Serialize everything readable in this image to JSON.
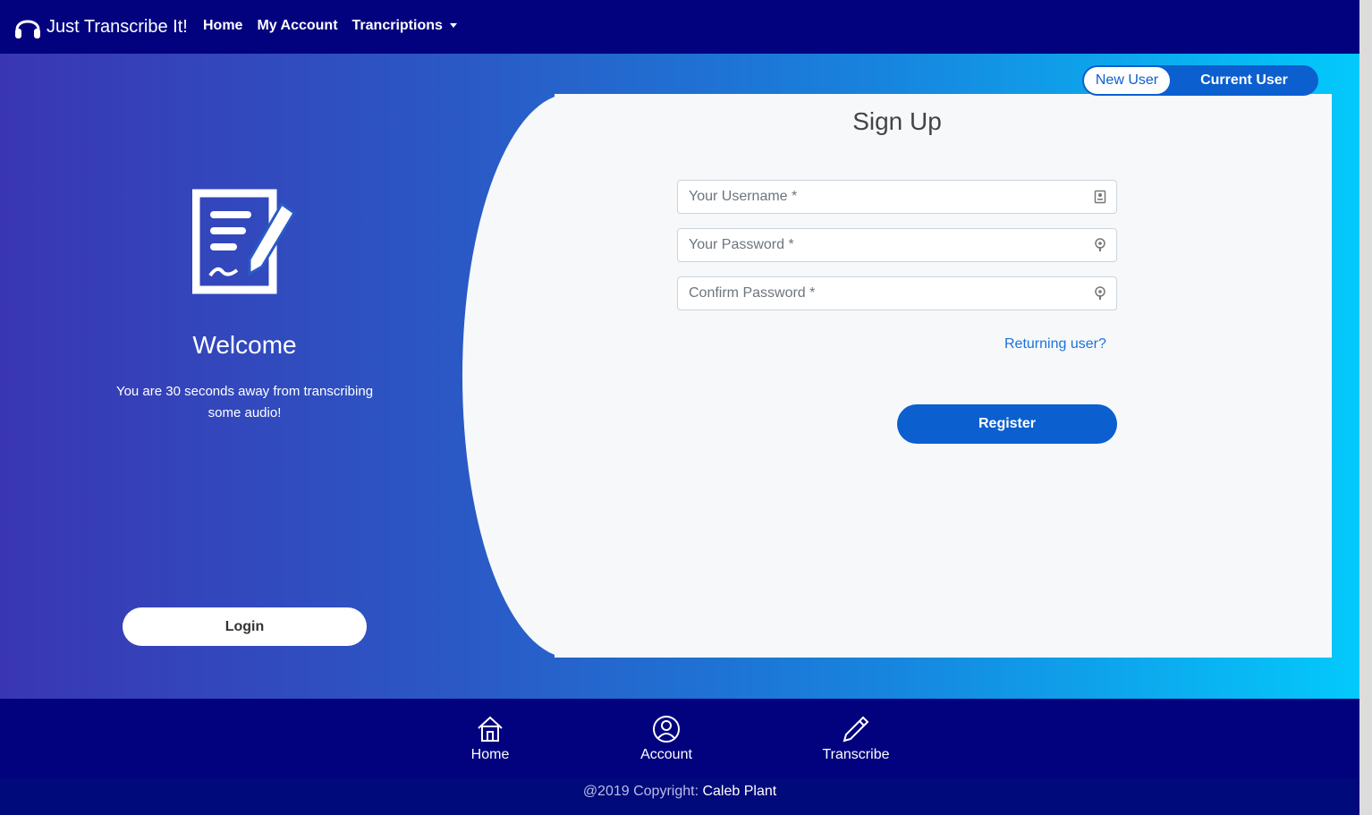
{
  "navbar": {
    "brand": "Just Transcribe It!",
    "links": [
      "Home",
      "My Account",
      "Trancriptions"
    ]
  },
  "left_panel": {
    "title": "Welcome",
    "subtitle": "You are 30 seconds away from transcribing some audio!",
    "login_label": "Login"
  },
  "toggle": {
    "new_user": "New User",
    "current_user": "Current User"
  },
  "form": {
    "title": "Sign Up",
    "username_placeholder": "Your Username *",
    "password_placeholder": "Your Password *",
    "confirm_placeholder": "Confirm Password *",
    "returning_link": "Returning user?",
    "register_label": "Register"
  },
  "footer": {
    "nav": [
      "Home",
      "Account",
      "Transcribe"
    ],
    "copyright_label": "@2019 Copyright:",
    "copyright_name": "Caleb Plant"
  },
  "colors": {
    "navbar": "#02027f",
    "accent": "#0b5fcf",
    "link": "#1a73d9",
    "gradient_start": "#3a36b3",
    "gradient_end": "#03c9fb"
  },
  "icons": {
    "brand": "headphones-icon",
    "left_panel": "document-pen-icon",
    "username_field": "id-card-icon",
    "password_field": "key-icon",
    "footer_home": "home-icon",
    "footer_account": "user-circle-icon",
    "footer_transcribe": "pencil-icon"
  }
}
